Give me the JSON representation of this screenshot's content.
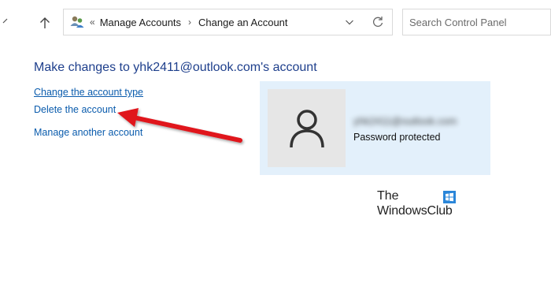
{
  "navigation": {
    "back_icon": "chevron-left-icon",
    "up_icon": "arrow-up-icon"
  },
  "address_bar": {
    "icon": "user-accounts-icon",
    "separator": "«",
    "breadcrumbs": [
      "Manage Accounts",
      "Change an Account"
    ],
    "crumb_separator": "›",
    "dropdown_icon": "chevron-down-icon",
    "refresh_icon": "refresh-icon"
  },
  "search": {
    "placeholder": "Search Control Panel"
  },
  "main": {
    "title": "Make changes to yhk2411@outlook.com's account",
    "links": [
      {
        "label": "Change the account type"
      },
      {
        "label": "Delete the account"
      },
      {
        "label": "Manage another account"
      }
    ]
  },
  "account_card": {
    "avatar_icon": "user-icon",
    "email": "yhk2411@outlook.com",
    "status": "Password protected"
  },
  "watermark": {
    "line1": "The",
    "line2": "WindowsClub"
  },
  "annotation": {
    "arrow_color": "#e0141c",
    "icon": "red-arrow-icon"
  },
  "colors": {
    "title": "#1e3f8c",
    "link": "#0b5cad",
    "card_bg": "#e3f0fb",
    "avatar_bg": "#e6e6e6"
  }
}
